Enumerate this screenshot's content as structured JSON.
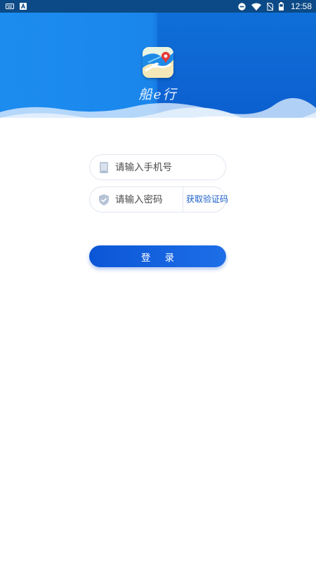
{
  "status_bar": {
    "time": "12:58",
    "left_icons": [
      "keyboard-icon",
      "a-notification-icon"
    ],
    "right_icons": [
      "do-not-disturb-icon",
      "wifi-icon",
      "no-sim-icon",
      "battery-icon"
    ]
  },
  "header": {
    "app_name": "船e行",
    "logo_icon": "app-map-logo-icon"
  },
  "form": {
    "phone_placeholder": "请输入手机号",
    "code_placeholder": "请输入密码",
    "get_code_label": "获取验证码"
  },
  "login": {
    "label": "登 录"
  },
  "colors": {
    "primary": "#0d5fd6",
    "header_left": "#1c8cef",
    "header_right": "#0d63d3",
    "link": "#1c5fc7"
  }
}
